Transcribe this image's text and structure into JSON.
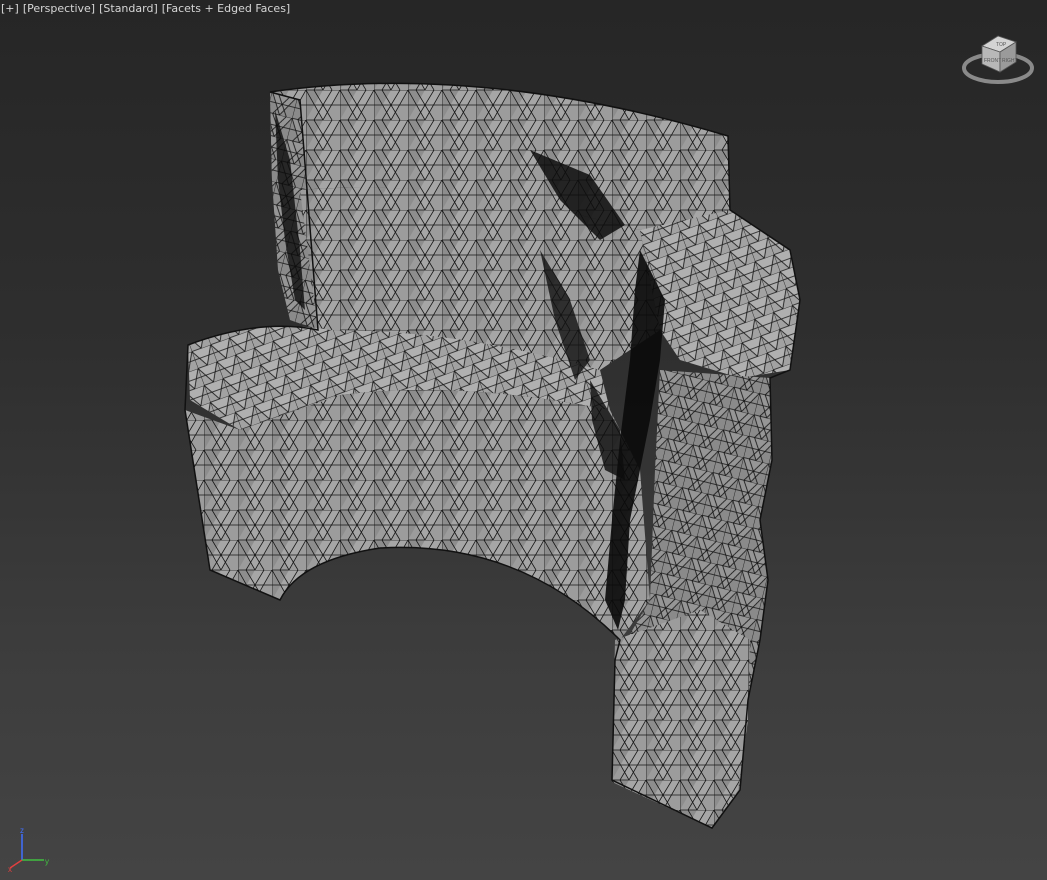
{
  "viewport": {
    "menu_plus": "[+]",
    "view_mode": "[Perspective]",
    "shading_preset": "[Standard]",
    "display_mode": "[Facets + Edged Faces]"
  },
  "viewcube": {
    "top_face_label": "TOP",
    "front_face_label": "FRONT",
    "right_face_label": "RIGHT"
  },
  "axis": {
    "x_label": "x",
    "y_label": "y",
    "z_label": "z",
    "x_color": "#e04040",
    "y_color": "#40c040",
    "z_color": "#4070ff"
  },
  "colors": {
    "background_top": "#262626",
    "background_bottom": "#444444",
    "mesh_face": "#9a9a9a",
    "mesh_edge": "#111111",
    "shadow": "#0a0a0a"
  }
}
